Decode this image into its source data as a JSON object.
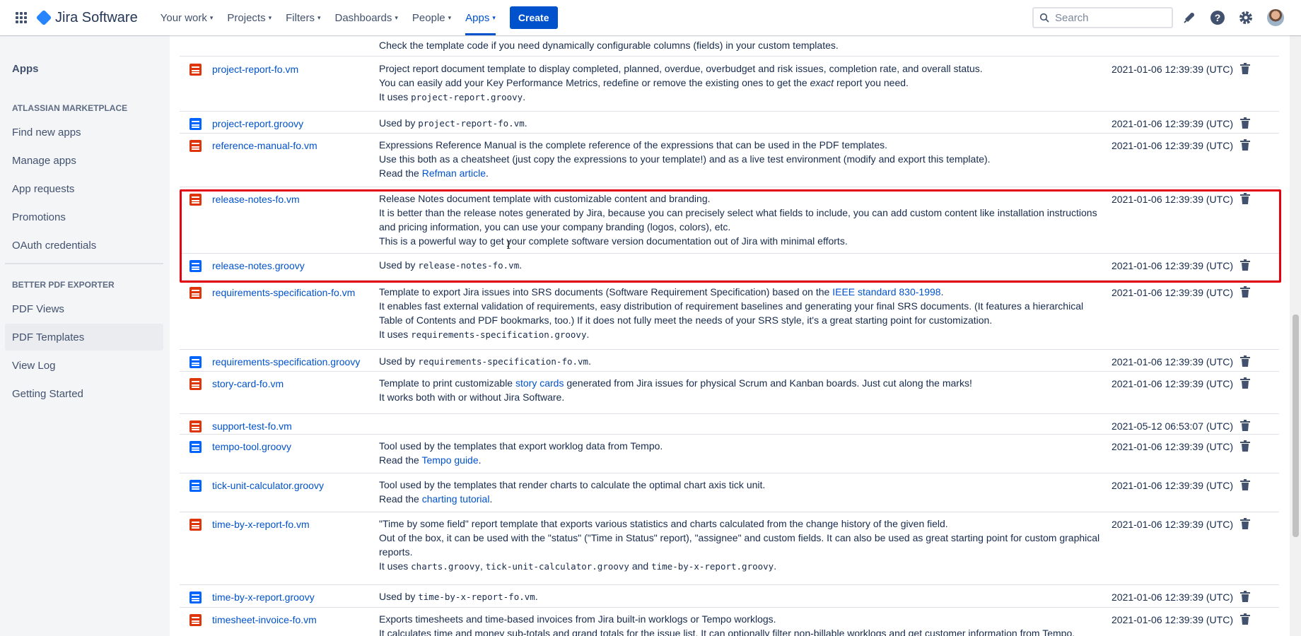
{
  "header": {
    "product": "Jira Software",
    "nav": [
      {
        "label": "Your work"
      },
      {
        "label": "Projects"
      },
      {
        "label": "Filters"
      },
      {
        "label": "Dashboards"
      },
      {
        "label": "People"
      },
      {
        "label": "Apps",
        "active": true
      }
    ],
    "create_label": "Create",
    "search_placeholder": "Search"
  },
  "sidebar": {
    "title": "Apps",
    "marketplace_heading": "ATLASSIAN MARKETPLACE",
    "marketplace_items": [
      "Find new apps",
      "Manage apps",
      "App requests",
      "Promotions",
      "OAuth credentials"
    ],
    "pdf_heading": "BETTER PDF EXPORTER",
    "pdf_items": [
      "PDF Views",
      "PDF Templates",
      "View Log",
      "Getting Started"
    ],
    "selected": "PDF Templates"
  },
  "templates": {
    "partial_top_line": "Check the template code if you need dynamically configurable columns (fields) in your custom templates.",
    "rows": [
      {
        "name": "project-report-fo.vm",
        "type": "fo",
        "date": "2021-01-06 12:39:39 (UTC)",
        "lines": [
          [
            {
              "t": "Project report document template to display completed, planned, overdue, overbudget and risk issues, completion rate, and overall status."
            }
          ],
          [
            {
              "t": "You can easily add your Key Performance Metrics, redefine or remove the existing ones to get the "
            },
            {
              "t": "exact",
              "s": "em"
            },
            {
              "t": " report you need."
            }
          ],
          [
            {
              "t": "It uses "
            },
            {
              "t": "project-report.groovy",
              "s": "code"
            },
            {
              "t": "."
            }
          ]
        ]
      },
      {
        "name": "project-report.groovy",
        "type": "groovy",
        "date": "2021-01-06 12:39:39 (UTC)",
        "lines": [
          [
            {
              "t": "Used by "
            },
            {
              "t": "project-report-fo.vm",
              "s": "code"
            },
            {
              "t": "."
            }
          ]
        ]
      },
      {
        "name": "reference-manual-fo.vm",
        "type": "fo",
        "date": "2021-01-06 12:39:39 (UTC)",
        "lines": [
          [
            {
              "t": "Expressions Reference Manual is the complete reference of the expressions that can be used in the PDF templates."
            }
          ],
          [
            {
              "t": "Use this both as a cheatsheet (just copy the expressions to your template!) and as a live test environment (modify and export this template)."
            }
          ],
          [
            {
              "t": "Read the "
            },
            {
              "t": "Refman article",
              "s": "link"
            },
            {
              "t": "."
            }
          ]
        ]
      },
      {
        "name": "release-notes-fo.vm",
        "type": "fo",
        "date": "2021-01-06 12:39:39 (UTC)",
        "lines": [
          [
            {
              "t": "Release Notes document template with customizable content and branding."
            }
          ],
          [
            {
              "t": "It is better than the release notes generated by Jira, because you can precisely select what fields to include, you can add custom content like installation instructions"
            }
          ],
          [
            {
              "t": "and pricing information, you can use your company branding (logos, colors), etc."
            }
          ],
          [
            {
              "t": "This is a powerful way to get your complete software version documentation out of Jira with minimal efforts."
            }
          ]
        ]
      },
      {
        "name": "release-notes.groovy",
        "type": "groovy",
        "date": "2021-01-06 12:39:39 (UTC)",
        "lines": [
          [
            {
              "t": "Used by "
            },
            {
              "t": "release-notes-fo.vm",
              "s": "code"
            },
            {
              "t": "."
            }
          ]
        ]
      },
      {
        "name": "requirements-specification-fo.vm",
        "type": "fo",
        "date": "2021-01-06 12:39:39 (UTC)",
        "lines": [
          [
            {
              "t": "Template to export Jira issues into SRS documents (Software Requirement Specification) based on the "
            },
            {
              "t": "IEEE standard 830-1998",
              "s": "link"
            },
            {
              "t": "."
            }
          ],
          [
            {
              "t": "It enables fast external validation of requirements, easy distribution of requirement baselines and generating your final SRS documents. (It features a hierarchical"
            }
          ],
          [
            {
              "t": "Table of Contents and PDF bookmarks, too.) If it does not fully meet the needs of your SRS style, it's a great starting point for customization."
            }
          ],
          [
            {
              "t": "It uses "
            },
            {
              "t": "requirements-specification.groovy",
              "s": "code"
            },
            {
              "t": "."
            }
          ]
        ]
      },
      {
        "name": "requirements-specification.groovy",
        "type": "groovy",
        "date": "2021-01-06 12:39:39 (UTC)",
        "lines": [
          [
            {
              "t": "Used by "
            },
            {
              "t": "requirements-specification-fo.vm",
              "s": "code"
            },
            {
              "t": "."
            }
          ]
        ]
      },
      {
        "name": "story-card-fo.vm",
        "type": "fo",
        "date": "2021-01-06 12:39:39 (UTC)",
        "lines": [
          [
            {
              "t": "Template to print customizable "
            },
            {
              "t": "story cards",
              "s": "link"
            },
            {
              "t": " generated from Jira issues for physical Scrum and Kanban boards. Just cut along the marks!"
            }
          ],
          [
            {
              "t": "It works both with or without Jira Software."
            }
          ]
        ]
      },
      {
        "name": "support-test-fo.vm",
        "type": "fo",
        "date": "2021-05-12 06:53:07 (UTC)",
        "lines": []
      },
      {
        "name": "tempo-tool.groovy",
        "type": "groovy",
        "date": "2021-01-06 12:39:39 (UTC)",
        "lines": [
          [
            {
              "t": "Tool used by the templates that export worklog data from Tempo."
            }
          ],
          [
            {
              "t": "Read the "
            },
            {
              "t": "Tempo guide",
              "s": "link"
            },
            {
              "t": "."
            }
          ]
        ]
      },
      {
        "name": "tick-unit-calculator.groovy",
        "type": "groovy",
        "date": "2021-01-06 12:39:39 (UTC)",
        "lines": [
          [
            {
              "t": "Tool used by the templates that render charts to calculate the optimal chart axis tick unit."
            }
          ],
          [
            {
              "t": "Read the "
            },
            {
              "t": "charting tutorial",
              "s": "link"
            },
            {
              "t": "."
            }
          ]
        ]
      },
      {
        "name": "time-by-x-report-fo.vm",
        "type": "fo",
        "date": "2021-01-06 12:39:39 (UTC)",
        "lines": [
          [
            {
              "t": "\"Time by some field\" report template that exports various statistics and charts calculated from the change history of the given field."
            }
          ],
          [
            {
              "t": "Out of the box, it can be used with the \"status\" (\"Time in Status\" report), \"assignee\" and custom fields. It can also be used as great starting point for custom graphical"
            }
          ],
          [
            {
              "t": "reports."
            }
          ],
          [
            {
              "t": "It uses "
            },
            {
              "t": "charts.groovy",
              "s": "code"
            },
            {
              "t": ", "
            },
            {
              "t": "tick-unit-calculator.groovy",
              "s": "code"
            },
            {
              "t": " and "
            },
            {
              "t": "time-by-x-report.groovy",
              "s": "code"
            },
            {
              "t": "."
            }
          ]
        ]
      },
      {
        "name": "time-by-x-report.groovy",
        "type": "groovy",
        "date": "2021-01-06 12:39:39 (UTC)",
        "lines": [
          [
            {
              "t": "Used by "
            },
            {
              "t": "time-by-x-report-fo.vm",
              "s": "code"
            },
            {
              "t": "."
            }
          ]
        ]
      },
      {
        "name": "timesheet-invoice-fo.vm",
        "type": "fo",
        "date": "2021-01-06 12:39:39 (UTC)",
        "lines": [
          [
            {
              "t": "Exports timesheets and time-based invoices from Jira built-in worklogs or Tempo worklogs."
            }
          ],
          [
            {
              "t": "It calculates time and money sub-totals and grand totals for the issue list. It can optionally filter non-billable worklogs and get customer information from Tempo."
            }
          ]
        ]
      }
    ]
  },
  "colors": {
    "accent": "#0052CC",
    "highlight_border": "#E3000F",
    "fo_icon": "#DE350B",
    "groovy_icon": "#0065FF"
  },
  "icons": [
    "app-switcher-icon",
    "jira-logo-icon",
    "search-icon",
    "notifications-icon",
    "help-icon",
    "settings-icon",
    "file-icon",
    "trash-icon"
  ]
}
